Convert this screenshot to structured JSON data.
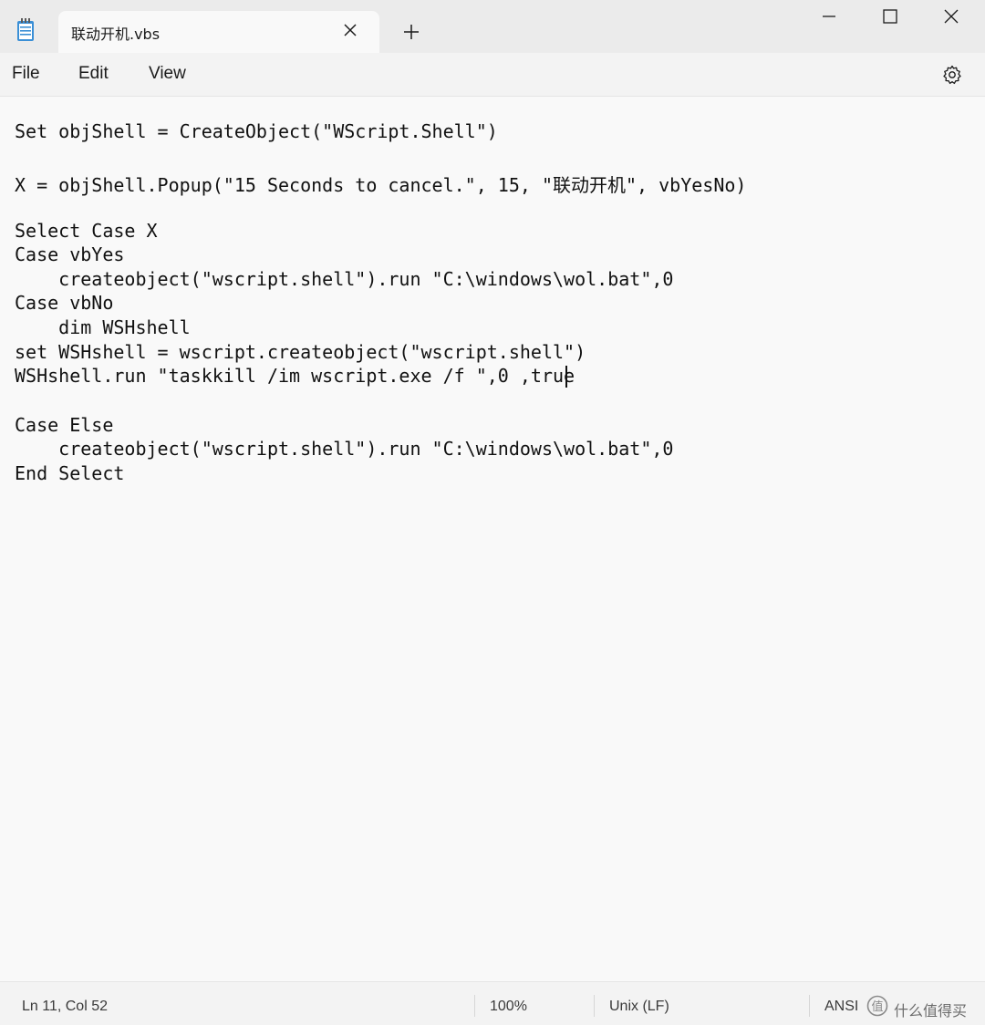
{
  "window": {
    "tab_title": "联动开机.vbs",
    "accent": "#0067c0"
  },
  "menu": {
    "file": "File",
    "edit": "Edit",
    "view": "View"
  },
  "icons": {
    "app": "notepad-icon",
    "tab_close": "close-icon",
    "new_tab": "plus-icon",
    "minimize": "minimize-icon",
    "maximize": "maximize-icon",
    "close": "close-icon",
    "settings": "gear-icon"
  },
  "editor": {
    "lines": [
      "Set objShell = CreateObject(\"WScript.Shell\")",
      "X = objShell.Popup(\"15 Seconds to cancel.\", 15, \"联动开机\", vbYesNo)",
      "Select Case X",
      "Case vbYes",
      "    createobject(\"wscript.shell\").run \"C:\\windows\\wol.bat\",0",
      "Case vbNo",
      "    dim WSHshell",
      "set WSHshell = wscript.createobject(\"wscript.shell\")",
      "WSHshell.run \"taskkill /im wscript.exe /f \",0 ,true",
      "Case Else",
      "    createobject(\"wscript.shell\").run \"C:\\windows\\wol.bat\",0",
      "End Select"
    ]
  },
  "status": {
    "position": "Ln 11, Col 52",
    "zoom": "100%",
    "line_ending": "Unix (LF)",
    "encoding": "ANSI"
  },
  "watermark": {
    "text": "什么值得买"
  }
}
